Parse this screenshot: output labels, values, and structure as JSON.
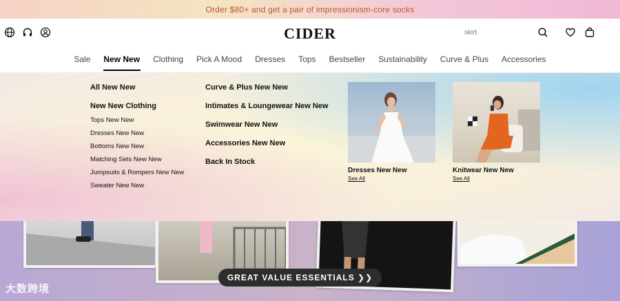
{
  "promo": {
    "text": "Order $80+ and get a pair of impressionism-core socks"
  },
  "header": {
    "logo": "CIDER",
    "search_placeholder": "skirt",
    "left_icons": [
      "globe-icon",
      "headset-icon",
      "account-icon"
    ],
    "right_icons": [
      "search-icon",
      "heart-icon",
      "bag-icon"
    ]
  },
  "nav": {
    "items": [
      {
        "label": "Sale"
      },
      {
        "label": "New New",
        "active": true
      },
      {
        "label": "Clothing"
      },
      {
        "label": "Pick A Mood"
      },
      {
        "label": "Dresses"
      },
      {
        "label": "Tops"
      },
      {
        "label": "Bestseller"
      },
      {
        "label": "Sustainability"
      },
      {
        "label": "Curve & Plus"
      },
      {
        "label": "Accessories"
      }
    ]
  },
  "dropdown": {
    "col1": {
      "all": "All New New",
      "clothing": "New New Clothing",
      "links": [
        "Tops New New",
        "Dresses New New",
        "Bottoms New New",
        "Matching Sets New New",
        "Jumpsuits & Rompers New New",
        "Sweater New New"
      ]
    },
    "col2": {
      "links": [
        "Curve & Plus New New",
        "Intimates & Loungewear New New",
        "Swimwear New New",
        "Accessories New New",
        "Back In Stock"
      ]
    },
    "cards": [
      {
        "label": "Dresses New New",
        "see": "See All"
      },
      {
        "label": "Knitwear New New",
        "see": "See All"
      }
    ]
  },
  "hero": {
    "cta": "GREAT VALUE ESSENTIALS ❯❯"
  },
  "watermark": "大数跨境",
  "colors": {
    "promo_text": "#b5562a",
    "cta_bg": "#2d2d2d"
  }
}
